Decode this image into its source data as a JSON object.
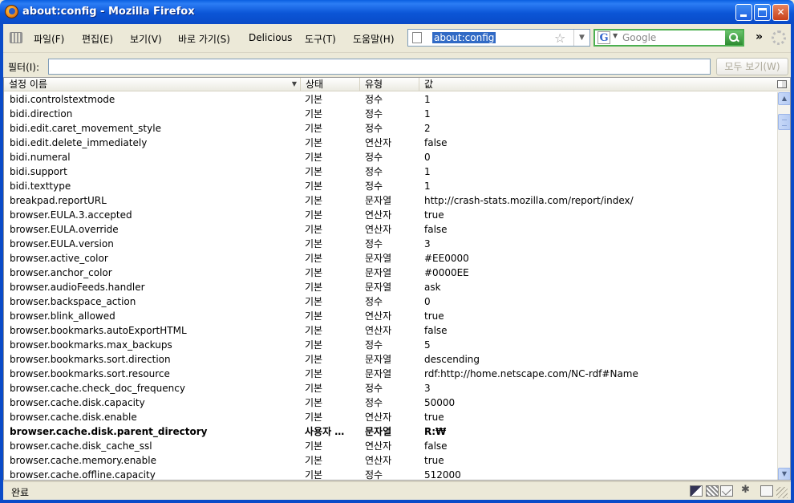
{
  "window": {
    "title": "about:config - Mozilla Firefox"
  },
  "menu": [
    {
      "label": "파일(F)",
      "name": "menu-file"
    },
    {
      "label": "편집(E)",
      "name": "menu-edit"
    },
    {
      "label": "보기(V)",
      "name": "menu-view"
    },
    {
      "label": "바로 가기(S)",
      "name": "menu-go"
    },
    {
      "label": "Delicious",
      "name": "menu-delicious"
    },
    {
      "label": "도구(T)",
      "name": "menu-tools"
    },
    {
      "label": "도움말(H)",
      "name": "menu-help"
    }
  ],
  "urlbar": {
    "value": "about:config"
  },
  "search": {
    "placeholder": "Google",
    "engine_letter": "G"
  },
  "toolbar": {
    "overflow": "»"
  },
  "filter": {
    "label": "필터(I):",
    "value": "",
    "show_all_label": "모두 보기(W)"
  },
  "columns": {
    "name": "설정 이름",
    "status": "상태",
    "type": "유형",
    "value": "값"
  },
  "rows": [
    {
      "name": "bidi.controlstextmode",
      "status": "기본",
      "type": "정수",
      "value": "1"
    },
    {
      "name": "bidi.direction",
      "status": "기본",
      "type": "정수",
      "value": "1"
    },
    {
      "name": "bidi.edit.caret_movement_style",
      "status": "기본",
      "type": "정수",
      "value": "2"
    },
    {
      "name": "bidi.edit.delete_immediately",
      "status": "기본",
      "type": "연산자",
      "value": "false"
    },
    {
      "name": "bidi.numeral",
      "status": "기본",
      "type": "정수",
      "value": "0"
    },
    {
      "name": "bidi.support",
      "status": "기본",
      "type": "정수",
      "value": "1"
    },
    {
      "name": "bidi.texttype",
      "status": "기본",
      "type": "정수",
      "value": "1"
    },
    {
      "name": "breakpad.reportURL",
      "status": "기본",
      "type": "문자열",
      "value": "http://crash-stats.mozilla.com/report/index/"
    },
    {
      "name": "browser.EULA.3.accepted",
      "status": "기본",
      "type": "연산자",
      "value": "true"
    },
    {
      "name": "browser.EULA.override",
      "status": "기본",
      "type": "연산자",
      "value": "false"
    },
    {
      "name": "browser.EULA.version",
      "status": "기본",
      "type": "정수",
      "value": "3"
    },
    {
      "name": "browser.active_color",
      "status": "기본",
      "type": "문자열",
      "value": "#EE0000"
    },
    {
      "name": "browser.anchor_color",
      "status": "기본",
      "type": "문자열",
      "value": "#0000EE"
    },
    {
      "name": "browser.audioFeeds.handler",
      "status": "기본",
      "type": "문자열",
      "value": "ask"
    },
    {
      "name": "browser.backspace_action",
      "status": "기본",
      "type": "정수",
      "value": "0"
    },
    {
      "name": "browser.blink_allowed",
      "status": "기본",
      "type": "연산자",
      "value": "true"
    },
    {
      "name": "browser.bookmarks.autoExportHTML",
      "status": "기본",
      "type": "연산자",
      "value": "false"
    },
    {
      "name": "browser.bookmarks.max_backups",
      "status": "기본",
      "type": "정수",
      "value": "5"
    },
    {
      "name": "browser.bookmarks.sort.direction",
      "status": "기본",
      "type": "문자열",
      "value": "descending"
    },
    {
      "name": "browser.bookmarks.sort.resource",
      "status": "기본",
      "type": "문자열",
      "value": "rdf:http://home.netscape.com/NC-rdf#Name"
    },
    {
      "name": "browser.cache.check_doc_frequency",
      "status": "기본",
      "type": "정수",
      "value": "3"
    },
    {
      "name": "browser.cache.disk.capacity",
      "status": "기본",
      "type": "정수",
      "value": "50000"
    },
    {
      "name": "browser.cache.disk.enable",
      "status": "기본",
      "type": "연산자",
      "value": "true"
    },
    {
      "name": "browser.cache.disk.parent_directory",
      "status": "사용자 …",
      "type": "문자열",
      "value": "R:₩",
      "user": true
    },
    {
      "name": "browser.cache.disk_cache_ssl",
      "status": "기본",
      "type": "연산자",
      "value": "false"
    },
    {
      "name": "browser.cache.memory.enable",
      "status": "기본",
      "type": "연산자",
      "value": "true"
    },
    {
      "name": "browser.cache.offline.capacity",
      "status": "기본",
      "type": "정수",
      "value": "512000"
    }
  ],
  "statusbar": {
    "text": "완료"
  },
  "icons": {
    "app": "firefox-icon",
    "grip": "toolbar-grip-icon",
    "page": "page-icon",
    "star": "bookmark-star-icon",
    "search_go": "search-go-icon",
    "throbber": "throbber-icon"
  }
}
